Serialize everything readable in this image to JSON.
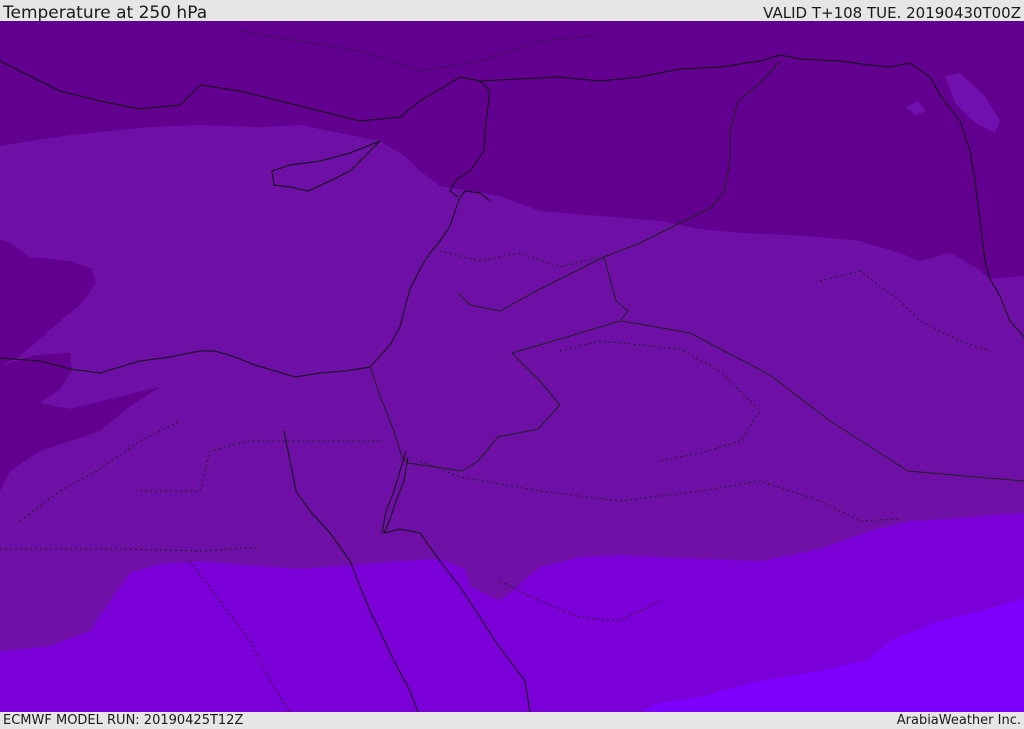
{
  "header": {
    "title": "Temperature at 250 hPa",
    "valid": "VALID T+108 TUE. 20190430T00Z"
  },
  "footer": {
    "model_run": "ECMWF MODEL RUN: 20190425T12Z",
    "credit": "ArabiaWeather Inc."
  },
  "colors": {
    "band_coldest": "#62008f",
    "band_cold": "#7010ad",
    "band_mid": "#6e0fa6",
    "band_warm": "#7b00d8",
    "band_warmest": "#7e00ff",
    "coastline": "#111111",
    "border": "#222222"
  }
}
